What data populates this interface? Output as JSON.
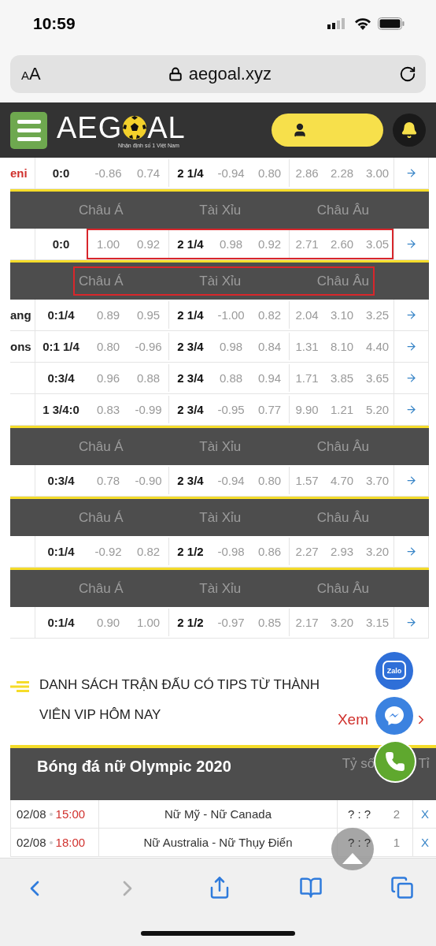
{
  "status_bar": {
    "time": "10:59"
  },
  "browser": {
    "text_size": "AA",
    "url": "aegoal.xyz"
  },
  "header": {
    "logo_parts": [
      "AEG",
      "AL"
    ],
    "tagline": "Nhận định số 1 Việt Nam"
  },
  "odds_blocks": [
    {
      "kind": "row",
      "team": "eni",
      "color": "#d0312d",
      "handicap": "0:0",
      "asian": [
        "-0.86",
        "0.74"
      ],
      "total_line": "2 1/4",
      "total": [
        "-0.94",
        "0.80"
      ],
      "european": [
        "2.86",
        "2.28",
        "3.00"
      ],
      "highlighted": false
    },
    {
      "kind": "header",
      "labels": [
        "Châu Á",
        "Tài Xỉu",
        "Châu Âu"
      ],
      "highlighted": false
    },
    {
      "kind": "row",
      "handicap": "0:0",
      "asian": [
        "1.00",
        "0.92"
      ],
      "total_line": "2 1/4",
      "total": [
        "0.98",
        "0.92"
      ],
      "european": [
        "2.71",
        "2.60",
        "3.05"
      ],
      "highlighted": true
    },
    {
      "kind": "header",
      "labels": [
        "Châu Á",
        "Tài Xỉu",
        "Châu Âu"
      ],
      "highlighted": true
    },
    {
      "kind": "row",
      "team": "ang",
      "color": "#222222",
      "handicap": "0:1/4",
      "asian": [
        "0.89",
        "0.95"
      ],
      "total_line": "2 1/4",
      "total": [
        "-1.00",
        "0.82"
      ],
      "european": [
        "2.04",
        "3.10",
        "3.25"
      ],
      "highlighted": false
    },
    {
      "kind": "row",
      "team": "ons",
      "color": "#222222",
      "handicap": "0:1 1/4",
      "asian": [
        "0.80",
        "-0.96"
      ],
      "total_line": "2 3/4",
      "total": [
        "0.98",
        "0.84"
      ],
      "european": [
        "1.31",
        "8.10",
        "4.40"
      ],
      "highlighted": false
    },
    {
      "kind": "row",
      "handicap": "0:3/4",
      "asian": [
        "0.96",
        "0.88"
      ],
      "total_line": "2 3/4",
      "total": [
        "0.88",
        "0.94"
      ],
      "european": [
        "1.71",
        "3.85",
        "3.65"
      ],
      "highlighted": false
    },
    {
      "kind": "row",
      "handicap": "1 3/4:0",
      "asian": [
        "0.83",
        "-0.99"
      ],
      "total_line": "2 3/4",
      "total": [
        "-0.95",
        "0.77"
      ],
      "european": [
        "9.90",
        "1.21",
        "5.20"
      ],
      "highlighted": false
    },
    {
      "kind": "header",
      "labels": [
        "Châu Á",
        "Tài Xỉu",
        "Châu Âu"
      ],
      "highlighted": false
    },
    {
      "kind": "row",
      "handicap": "0:3/4",
      "asian": [
        "0.78",
        "-0.90"
      ],
      "total_line": "2 3/4",
      "total": [
        "-0.94",
        "0.80"
      ],
      "european": [
        "1.57",
        "4.70",
        "3.70"
      ],
      "highlighted": false
    },
    {
      "kind": "header",
      "labels": [
        "Châu Á",
        "Tài Xỉu",
        "Châu Âu"
      ],
      "highlighted": false
    },
    {
      "kind": "row",
      "handicap": "0:1/4",
      "asian": [
        "-0.92",
        "0.82"
      ],
      "total_line": "2 1/2",
      "total": [
        "-0.98",
        "0.86"
      ],
      "european": [
        "2.27",
        "2.93",
        "3.20"
      ],
      "highlighted": false
    },
    {
      "kind": "header",
      "labels": [
        "Châu Á",
        "Tài Xỉu",
        "Châu Âu"
      ],
      "highlighted": false
    },
    {
      "kind": "row",
      "handicap": "0:1/4",
      "asian": [
        "0.90",
        "1.00"
      ],
      "total_line": "2 1/2",
      "total": [
        "-0.97",
        "0.85"
      ],
      "european": [
        "2.17",
        "3.20",
        "3.15"
      ],
      "highlighted": false
    }
  ],
  "section": {
    "title": "DANH SÁCH TRẬN ĐẤU CÓ TIPS TỪ THÀNH VIÊN VIP HÔM NAY",
    "link": "Xem"
  },
  "table": {
    "title": "Bóng đá nữ Olympic 2020",
    "columns": [
      "Tỷ số",
      "Tỉ"
    ],
    "rows": [
      {
        "date": "02/08",
        "time": "15:00",
        "match": "Nữ Mỹ - Nữ Canada",
        "score": "? : ?",
        "column_4": "2",
        "link": "X"
      },
      {
        "date": "02/08",
        "time": "18:00",
        "match": "Nữ Australia - Nữ Thụy Điển",
        "score": "? : ?",
        "column_4": "1",
        "link": "X"
      }
    ]
  },
  "floating": {
    "zalo_label": "Zalo"
  },
  "toolbar": {
    "back_disabled": false,
    "forward_disabled": true
  }
}
